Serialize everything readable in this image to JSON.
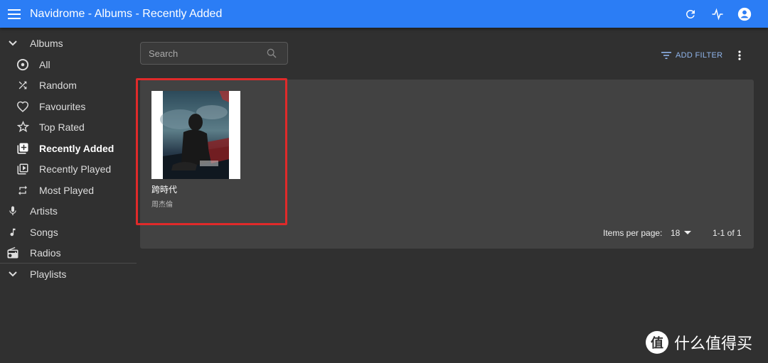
{
  "app": {
    "title": "Navidrome - Albums - Recently Added"
  },
  "sidebar": {
    "albums_label": "Albums",
    "items": [
      {
        "label": "All",
        "icon": "album-icon"
      },
      {
        "label": "Random",
        "icon": "shuffle-icon"
      },
      {
        "label": "Favourites",
        "icon": "heart-icon"
      },
      {
        "label": "Top Rated",
        "icon": "star-icon"
      },
      {
        "label": "Recently Added",
        "icon": "library-add-icon",
        "active": true
      },
      {
        "label": "Recently Played",
        "icon": "video-library-icon"
      },
      {
        "label": "Most Played",
        "icon": "repeat-icon"
      }
    ],
    "artists_label": "Artists",
    "songs_label": "Songs",
    "radios_label": "Radios",
    "playlists_label": "Playlists"
  },
  "toolbar": {
    "search_placeholder": "Search",
    "add_filter_label": "ADD FILTER"
  },
  "albums": [
    {
      "title": "跨時代",
      "artist": "周杰倫"
    }
  ],
  "pagination": {
    "items_per_page_label": "Items per page:",
    "items_per_page": "18",
    "range": "1-1 of 1"
  },
  "watermark": {
    "text": "什么值得买",
    "logo": "值"
  },
  "colors": {
    "appbar": "#2b7df5",
    "background": "#303030",
    "panel": "#424242",
    "highlight": "#e02a2a",
    "accent": "#8fb4ea"
  }
}
